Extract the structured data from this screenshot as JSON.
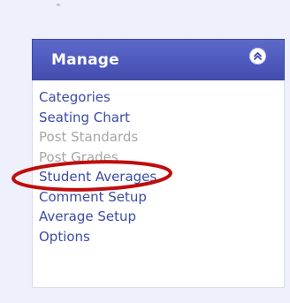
{
  "panel": {
    "title": "Manage",
    "collapse_icon": "double-chevron-up-icon",
    "accent_color": "#4f5abe"
  },
  "menu": {
    "items": [
      {
        "label": "Categories",
        "enabled": true
      },
      {
        "label": "Seating Chart",
        "enabled": true
      },
      {
        "label": "Post Standards",
        "enabled": false
      },
      {
        "label": "Post Grades",
        "enabled": false
      },
      {
        "label": "Student Averages",
        "enabled": true
      },
      {
        "label": "Comment Setup",
        "enabled": true
      },
      {
        "label": "Average Setup",
        "enabled": true
      },
      {
        "label": "Options",
        "enabled": true
      }
    ]
  },
  "annotation": {
    "shape": "ellipse",
    "color": "#c00d0d",
    "highlights": "Post Grades"
  }
}
